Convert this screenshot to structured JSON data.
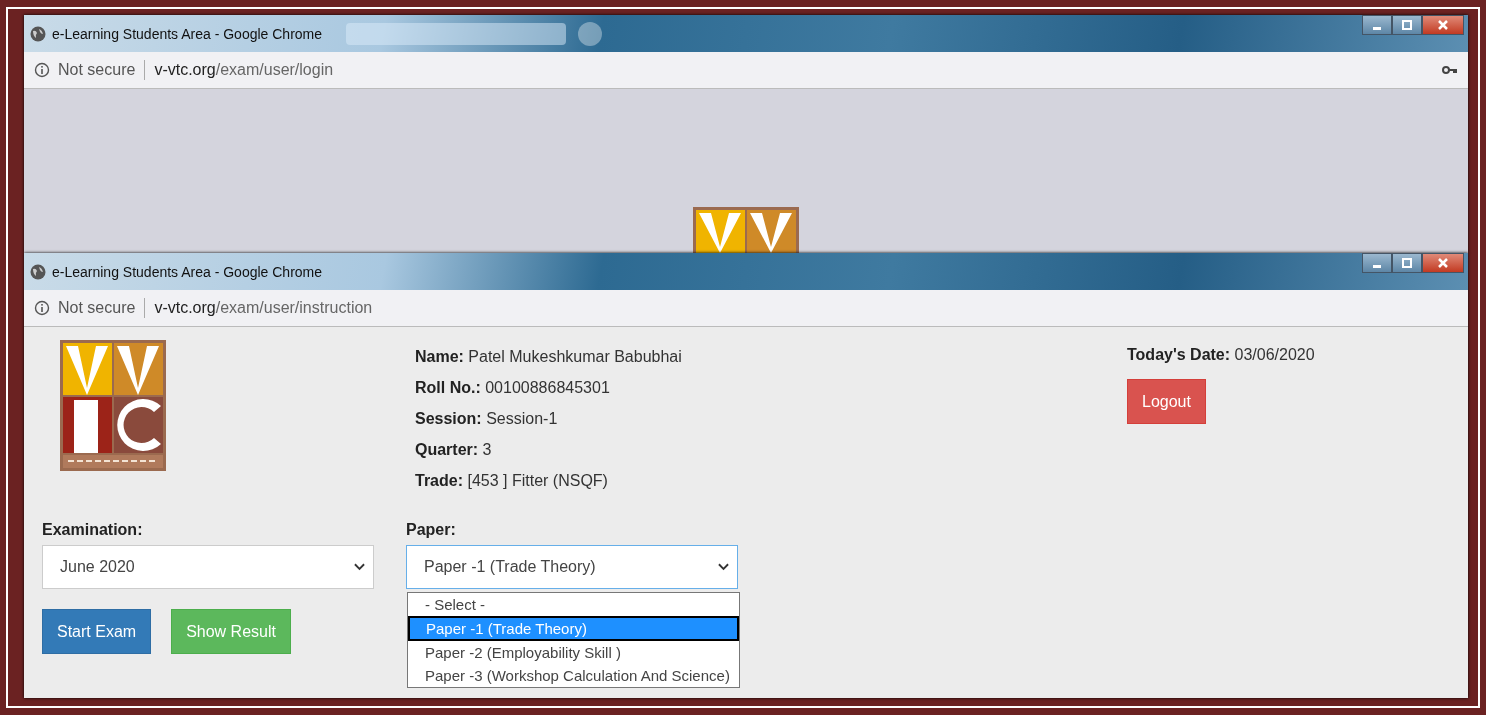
{
  "windows": [
    {
      "title": "e-Learning Students Area - Google Chrome",
      "security": "Not secure",
      "url_domain": "v-vtc.org",
      "url_path": "/exam/user/login"
    },
    {
      "title": "e-Learning Students Area - Google Chrome",
      "security": "Not secure",
      "url_domain": "v-vtc.org",
      "url_path": "/exam/user/instruction"
    }
  ],
  "profile": [
    {
      "label": "Name:",
      "value": "Patel Mukeshkumar Babubhai"
    },
    {
      "label": "Roll No.:",
      "value": "00100886845301"
    },
    {
      "label": "Session:",
      "value": "Session-1"
    },
    {
      "label": "Quarter:",
      "value": "3"
    },
    {
      "label": "Trade:",
      "value": "[453 ] Fitter (NSQF)"
    }
  ],
  "date": {
    "label": "Today's Date:",
    "value": "03/06/2020"
  },
  "logout": "Logout",
  "examination": {
    "label": "Examination:",
    "value": "June 2020"
  },
  "paper": {
    "label": "Paper:",
    "value": "Paper -1 (Trade Theory)",
    "options": [
      {
        "label": "- Select -",
        "selected": false
      },
      {
        "label": "Paper -1 (Trade Theory)",
        "selected": true
      },
      {
        "label": "Paper -2 (Employability Skill )",
        "selected": false
      },
      {
        "label": "Paper -3 (Workshop Calculation And Science)",
        "selected": false
      }
    ]
  },
  "buttons": [
    {
      "label": "Start Exam",
      "kind": "primary"
    },
    {
      "label": "Show Result",
      "kind": "success"
    }
  ]
}
